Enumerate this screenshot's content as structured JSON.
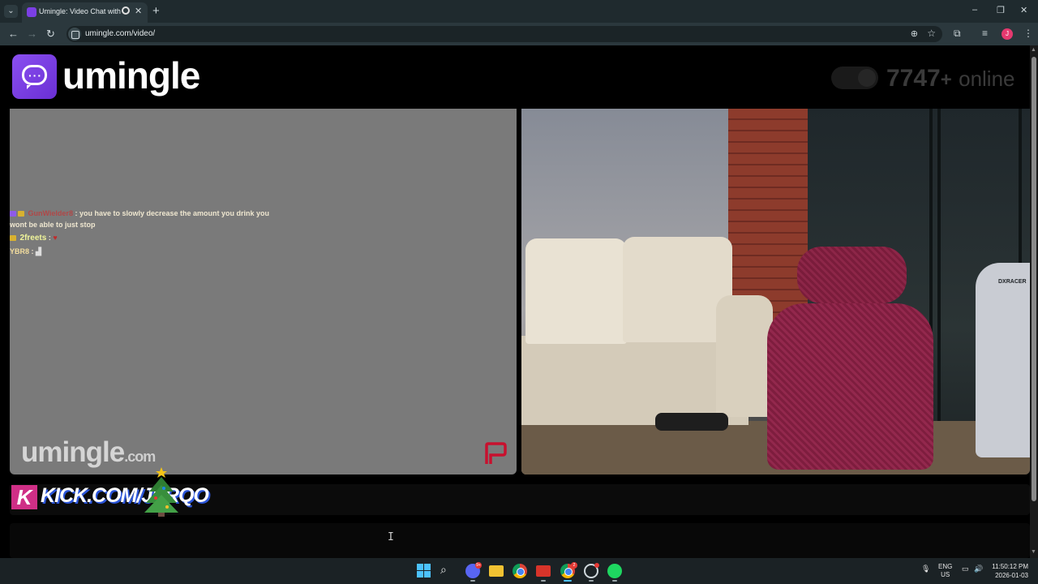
{
  "browser": {
    "tab_title": "Umingle: Video Chat with S",
    "url": "umingle.com/video/",
    "icons": [
      "tab-search-icon",
      "record-icon",
      "close-icon",
      "new-tab-icon",
      "back-icon",
      "forward-icon",
      "reload-icon",
      "zoom-icon",
      "bookmark-star-icon",
      "extensions-icon",
      "media-control-icon",
      "profile-icon",
      "menu-icon"
    ],
    "profile_initial": "J",
    "window_controls": {
      "minimize": "–",
      "restore": "❐",
      "close": "✕"
    }
  },
  "site": {
    "logo_text": "umingle",
    "online_count": "7747",
    "online_plus": "+",
    "online_label": "online"
  },
  "chat": {
    "messages": [
      {
        "user": "GunWielder8",
        "text": ": you have to slowly decrease the amount you drink you",
        "continuation": "wont be able to just stop"
      },
      {
        "user": "2freets",
        "text": ":"
      },
      {
        "user": "YBR8",
        "text": ":"
      }
    ]
  },
  "video": {
    "watermark_main": "umingle",
    "watermark_suffix": ".com",
    "chair_brand": "DXRACER"
  },
  "overlay": {
    "kick_text": "KICK.COM/JERQO",
    "kick_letter": "K"
  },
  "taskbar": {
    "apps": [
      "windows-start",
      "search",
      "discord",
      "file-explorer",
      "chrome",
      "app-red",
      "chrome-profile",
      "steam",
      "spotify"
    ],
    "discord_badge": "9+",
    "chrome_badge": "2",
    "lang_line1": "ENG",
    "lang_line2": "US",
    "time": "11:50:12 PM",
    "date": "2026-01-03"
  },
  "colors": {
    "brand_purple": "#7b3fe4",
    "kick_pink": "#cf2f86",
    "video_bg_left": "#7a7a7a"
  }
}
